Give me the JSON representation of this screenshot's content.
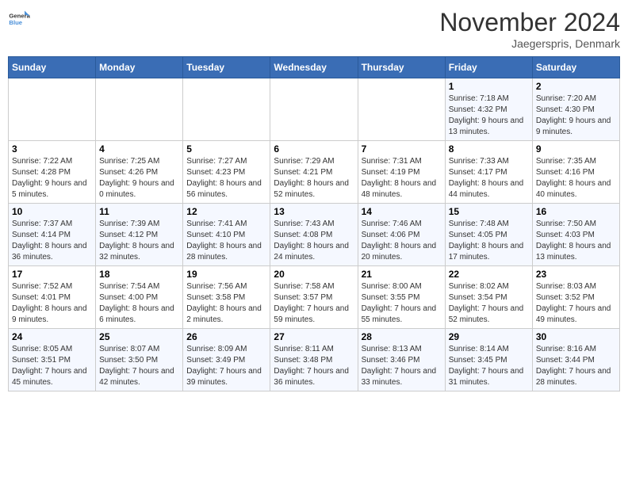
{
  "header": {
    "logo_general": "General",
    "logo_blue": "Blue",
    "month_title": "November 2024",
    "location": "Jaegerspris, Denmark"
  },
  "days_of_week": [
    "Sunday",
    "Monday",
    "Tuesday",
    "Wednesday",
    "Thursday",
    "Friday",
    "Saturday"
  ],
  "weeks": [
    [
      {
        "day": "",
        "sunrise": "",
        "sunset": "",
        "daylight": ""
      },
      {
        "day": "",
        "sunrise": "",
        "sunset": "",
        "daylight": ""
      },
      {
        "day": "",
        "sunrise": "",
        "sunset": "",
        "daylight": ""
      },
      {
        "day": "",
        "sunrise": "",
        "sunset": "",
        "daylight": ""
      },
      {
        "day": "",
        "sunrise": "",
        "sunset": "",
        "daylight": ""
      },
      {
        "day": "1",
        "sunrise": "Sunrise: 7:18 AM",
        "sunset": "Sunset: 4:32 PM",
        "daylight": "Daylight: 9 hours and 13 minutes."
      },
      {
        "day": "2",
        "sunrise": "Sunrise: 7:20 AM",
        "sunset": "Sunset: 4:30 PM",
        "daylight": "Daylight: 9 hours and 9 minutes."
      }
    ],
    [
      {
        "day": "3",
        "sunrise": "Sunrise: 7:22 AM",
        "sunset": "Sunset: 4:28 PM",
        "daylight": "Daylight: 9 hours and 5 minutes."
      },
      {
        "day": "4",
        "sunrise": "Sunrise: 7:25 AM",
        "sunset": "Sunset: 4:26 PM",
        "daylight": "Daylight: 9 hours and 0 minutes."
      },
      {
        "day": "5",
        "sunrise": "Sunrise: 7:27 AM",
        "sunset": "Sunset: 4:23 PM",
        "daylight": "Daylight: 8 hours and 56 minutes."
      },
      {
        "day": "6",
        "sunrise": "Sunrise: 7:29 AM",
        "sunset": "Sunset: 4:21 PM",
        "daylight": "Daylight: 8 hours and 52 minutes."
      },
      {
        "day": "7",
        "sunrise": "Sunrise: 7:31 AM",
        "sunset": "Sunset: 4:19 PM",
        "daylight": "Daylight: 8 hours and 48 minutes."
      },
      {
        "day": "8",
        "sunrise": "Sunrise: 7:33 AM",
        "sunset": "Sunset: 4:17 PM",
        "daylight": "Daylight: 8 hours and 44 minutes."
      },
      {
        "day": "9",
        "sunrise": "Sunrise: 7:35 AM",
        "sunset": "Sunset: 4:16 PM",
        "daylight": "Daylight: 8 hours and 40 minutes."
      }
    ],
    [
      {
        "day": "10",
        "sunrise": "Sunrise: 7:37 AM",
        "sunset": "Sunset: 4:14 PM",
        "daylight": "Daylight: 8 hours and 36 minutes."
      },
      {
        "day": "11",
        "sunrise": "Sunrise: 7:39 AM",
        "sunset": "Sunset: 4:12 PM",
        "daylight": "Daylight: 8 hours and 32 minutes."
      },
      {
        "day": "12",
        "sunrise": "Sunrise: 7:41 AM",
        "sunset": "Sunset: 4:10 PM",
        "daylight": "Daylight: 8 hours and 28 minutes."
      },
      {
        "day": "13",
        "sunrise": "Sunrise: 7:43 AM",
        "sunset": "Sunset: 4:08 PM",
        "daylight": "Daylight: 8 hours and 24 minutes."
      },
      {
        "day": "14",
        "sunrise": "Sunrise: 7:46 AM",
        "sunset": "Sunset: 4:06 PM",
        "daylight": "Daylight: 8 hours and 20 minutes."
      },
      {
        "day": "15",
        "sunrise": "Sunrise: 7:48 AM",
        "sunset": "Sunset: 4:05 PM",
        "daylight": "Daylight: 8 hours and 17 minutes."
      },
      {
        "day": "16",
        "sunrise": "Sunrise: 7:50 AM",
        "sunset": "Sunset: 4:03 PM",
        "daylight": "Daylight: 8 hours and 13 minutes."
      }
    ],
    [
      {
        "day": "17",
        "sunrise": "Sunrise: 7:52 AM",
        "sunset": "Sunset: 4:01 PM",
        "daylight": "Daylight: 8 hours and 9 minutes."
      },
      {
        "day": "18",
        "sunrise": "Sunrise: 7:54 AM",
        "sunset": "Sunset: 4:00 PM",
        "daylight": "Daylight: 8 hours and 6 minutes."
      },
      {
        "day": "19",
        "sunrise": "Sunrise: 7:56 AM",
        "sunset": "Sunset: 3:58 PM",
        "daylight": "Daylight: 8 hours and 2 minutes."
      },
      {
        "day": "20",
        "sunrise": "Sunrise: 7:58 AM",
        "sunset": "Sunset: 3:57 PM",
        "daylight": "Daylight: 7 hours and 59 minutes."
      },
      {
        "day": "21",
        "sunrise": "Sunrise: 8:00 AM",
        "sunset": "Sunset: 3:55 PM",
        "daylight": "Daylight: 7 hours and 55 minutes."
      },
      {
        "day": "22",
        "sunrise": "Sunrise: 8:02 AM",
        "sunset": "Sunset: 3:54 PM",
        "daylight": "Daylight: 7 hours and 52 minutes."
      },
      {
        "day": "23",
        "sunrise": "Sunrise: 8:03 AM",
        "sunset": "Sunset: 3:52 PM",
        "daylight": "Daylight: 7 hours and 49 minutes."
      }
    ],
    [
      {
        "day": "24",
        "sunrise": "Sunrise: 8:05 AM",
        "sunset": "Sunset: 3:51 PM",
        "daylight": "Daylight: 7 hours and 45 minutes."
      },
      {
        "day": "25",
        "sunrise": "Sunrise: 8:07 AM",
        "sunset": "Sunset: 3:50 PM",
        "daylight": "Daylight: 7 hours and 42 minutes."
      },
      {
        "day": "26",
        "sunrise": "Sunrise: 8:09 AM",
        "sunset": "Sunset: 3:49 PM",
        "daylight": "Daylight: 7 hours and 39 minutes."
      },
      {
        "day": "27",
        "sunrise": "Sunrise: 8:11 AM",
        "sunset": "Sunset: 3:48 PM",
        "daylight": "Daylight: 7 hours and 36 minutes."
      },
      {
        "day": "28",
        "sunrise": "Sunrise: 8:13 AM",
        "sunset": "Sunset: 3:46 PM",
        "daylight": "Daylight: 7 hours and 33 minutes."
      },
      {
        "day": "29",
        "sunrise": "Sunrise: 8:14 AM",
        "sunset": "Sunset: 3:45 PM",
        "daylight": "Daylight: 7 hours and 31 minutes."
      },
      {
        "day": "30",
        "sunrise": "Sunrise: 8:16 AM",
        "sunset": "Sunset: 3:44 PM",
        "daylight": "Daylight: 7 hours and 28 minutes."
      }
    ]
  ]
}
